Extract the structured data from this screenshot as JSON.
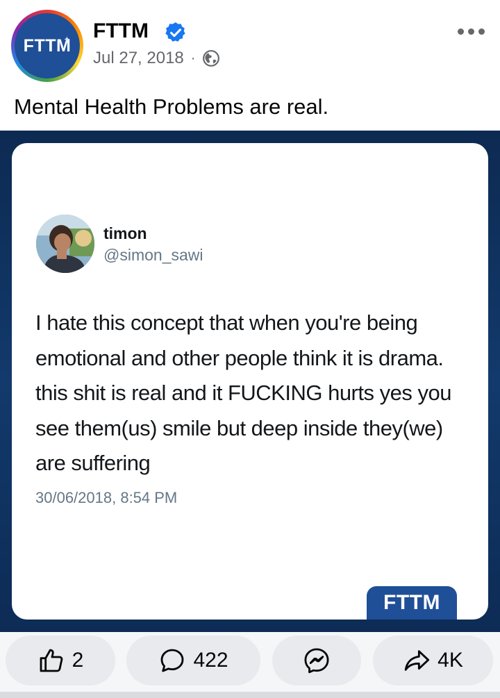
{
  "post": {
    "page_name": "FTTM",
    "avatar_text": "FTTM",
    "date": "Jul 27, 2018",
    "separator": "·",
    "caption": "Mental Health Problems are real."
  },
  "tweet": {
    "name": "timon",
    "handle": "@simon_sawi",
    "text": "I hate this concept that when you're being emotional and other people think it is drama. this shit is real and it FUCKING hurts yes you see them(us) smile but deep inside they(we) are suffering",
    "timestamp": "30/06/2018, 8:54 PM",
    "watermark": "FTTM"
  },
  "actions": {
    "likes": "2",
    "comments": "422",
    "shares": "4K"
  },
  "icons": {
    "verified": "verified-badge-icon",
    "audience": "globe-icon",
    "more": "more-options-icon",
    "like": "thumbs-up-icon",
    "comment": "comment-bubble-icon",
    "messenger": "messenger-icon",
    "share": "share-arrow-icon"
  },
  "colors": {
    "brand_blue": "#1f4f97",
    "verified_blue": "#1877f2",
    "image_background": "#123a6c"
  }
}
